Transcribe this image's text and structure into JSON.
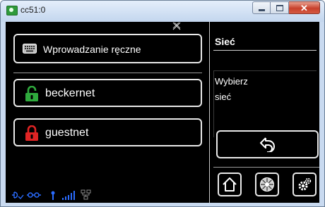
{
  "window": {
    "title": "cc51:0",
    "controls": {
      "minimize": "minimize",
      "maximize": "maximize",
      "close": "close"
    }
  },
  "left_panel": {
    "manual_entry": {
      "label": "Wprowadzanie ręczne",
      "icon": "keyboard-icon"
    },
    "networks": [
      {
        "label": "beckernet",
        "icon": "lock-open-icon",
        "color": "#2faa3d"
      },
      {
        "label": "guestnet",
        "icon": "lock-closed-icon",
        "color": "#e02424"
      }
    ],
    "status_icons": [
      "power-icon",
      "network-icon",
      "antenna-icon",
      "signal-bars-icon",
      "lan-icon"
    ]
  },
  "right_panel": {
    "title": "Sieć",
    "prompt_line1": "Wybierz",
    "prompt_line2": "sieć",
    "back_icon": "back-icon",
    "bottom_buttons": [
      "home-icon",
      "disc-icon",
      "settings-icon"
    ]
  },
  "colors": {
    "background": "#000000",
    "border": "#e9e9e9",
    "status_blue": "#2a6cff"
  }
}
